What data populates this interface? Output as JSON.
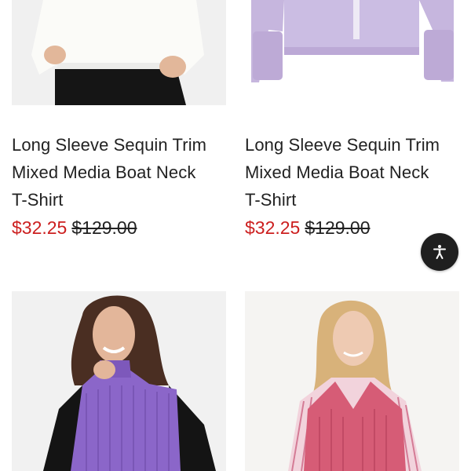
{
  "products": [
    {
      "name_lines": [
        "Long Sleeve Sequin Trim",
        "Mixed Media Boat Neck",
        "T-Shirt"
      ],
      "sale_price": "$32.25",
      "original_price": "$129.00"
    },
    {
      "name_lines": [
        "Long Sleeve Sequin Trim",
        "Mixed Media Boat Neck",
        "T-Shirt"
      ],
      "sale_price": "$32.25",
      "original_price": "$129.00"
    }
  ],
  "accessibility_button": {
    "icon": "accessibility-icon"
  },
  "colors": {
    "sale_price": "#cc1f1f",
    "accessibility_button_bg": "#1f1f1f",
    "lavender_top": "#c9b8e0",
    "purple_vest": "#8a63c8",
    "pink_vest": "#d35a73"
  }
}
